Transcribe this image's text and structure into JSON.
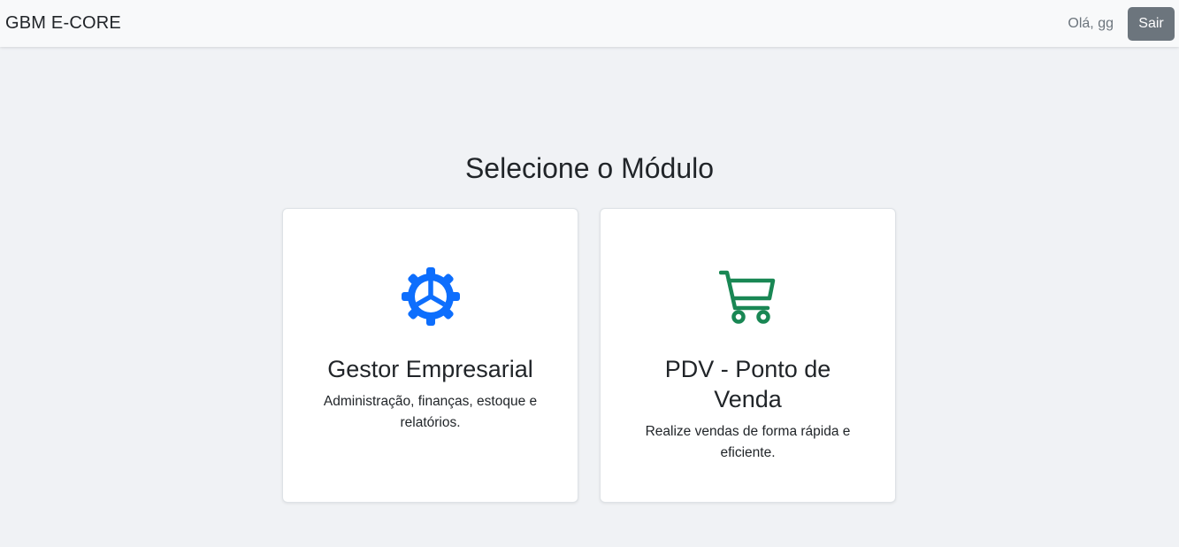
{
  "navbar": {
    "brand": "GBM E-CORE",
    "greeting": "Olá, gg",
    "logout_label": "Sair"
  },
  "main": {
    "title": "Selecione o Módulo",
    "modules": [
      {
        "title": "Gestor Empresarial",
        "description": "Administração, finanças, estoque e relatórios.",
        "icon": "gear-icon",
        "color": "#0d6efd"
      },
      {
        "title": "PDV - Ponto de Venda",
        "description": "Realize vendas de forma rápida e eficiente.",
        "icon": "cart-icon",
        "color": "#198754"
      }
    ]
  }
}
